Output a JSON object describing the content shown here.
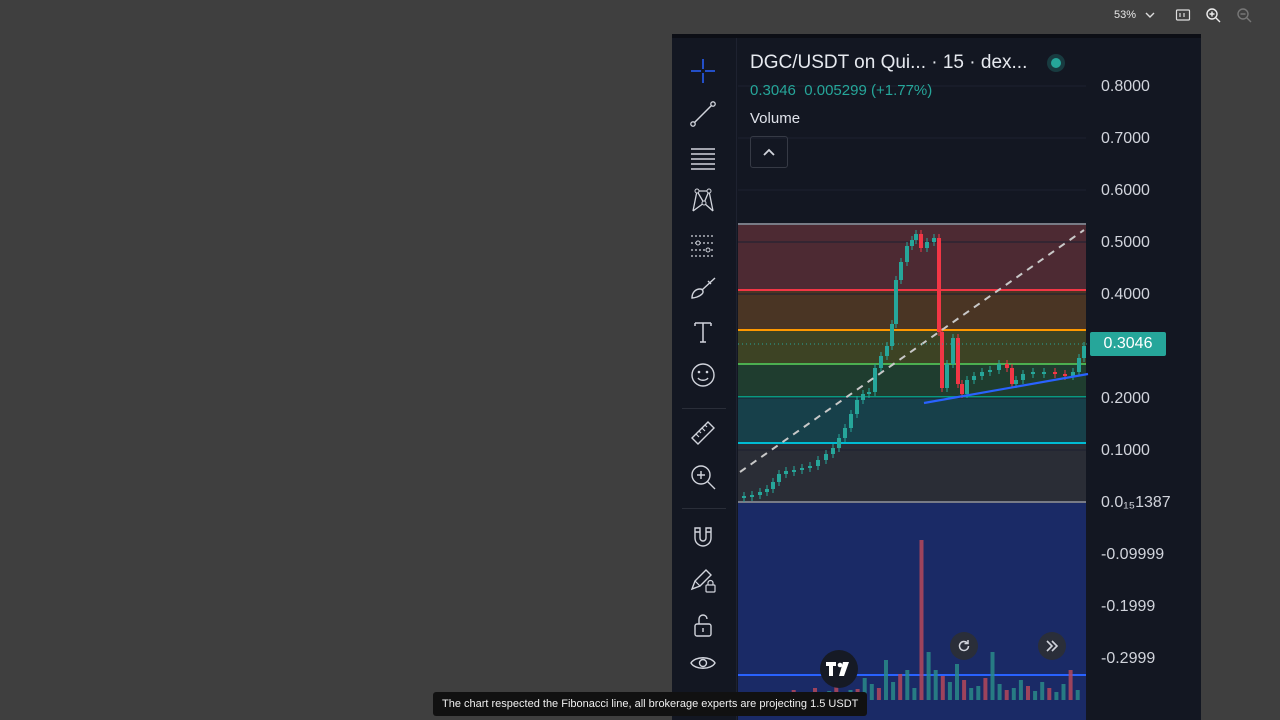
{
  "viewer": {
    "zoom": "53%"
  },
  "chart_header": {
    "title": "DGC/USDT on Qui... · 15 · dex...",
    "price": "0.3046",
    "change": "0.005299 (+1.77%)",
    "volume_label": "Volume"
  },
  "price_tag": "0.3046",
  "price_axis": [
    "0.8000",
    "0.7000",
    "0.6000",
    "0.5000",
    "0.4000",
    "0.2000",
    "0.1000",
    "0.0₁₅1387",
    "-0.09999",
    "-0.1999",
    "-0.2999"
  ],
  "toolbar": [
    "crosshair-tool",
    "trend-line-tool",
    "fib-retracement-tool",
    "pattern-tool",
    "forecast-tool",
    "brush-tool",
    "text-tool",
    "emoji-tool",
    "ruler-tool",
    "zoom-in-tool",
    "magnet-tool",
    "lock-drawing-tool",
    "unlock-tool",
    "eye-tool"
  ],
  "fibonacci_colors": {
    "zone1": "#4d2a33",
    "zone2": "#4a3524",
    "zone3": "#3d4324",
    "zone4": "#1f3d2f",
    "zone5": "#17404a",
    "zone6": "#2a2d36",
    "zone7": "#1a2a66",
    "line_red": "#f23645",
    "line_orange": "#ff9800",
    "line_green": "#4caf50",
    "line_teal": "#089981",
    "line_cyan": "#00bcd4",
    "line_grey": "#787b86",
    "line_blue": "#2962ff"
  },
  "caption": "The chart respected the Fibonacci line, all brokerage experts are projecting 1.5 USDT"
}
